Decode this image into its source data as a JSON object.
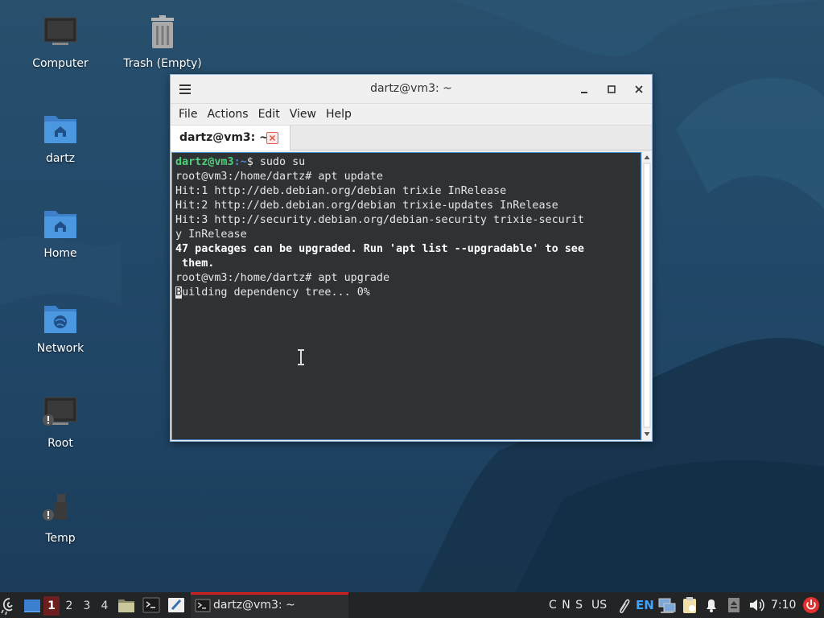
{
  "desktop": {
    "icons": [
      {
        "label": "Computer"
      },
      {
        "label": "Trash (Empty)"
      },
      {
        "label": "dartz"
      },
      {
        "label": "Home"
      },
      {
        "label": "Network"
      },
      {
        "label": "Root"
      },
      {
        "label": "Temp"
      }
    ]
  },
  "window": {
    "title": "dartz@vm3: ~",
    "menu": [
      "File",
      "Actions",
      "Edit",
      "View",
      "Help"
    ],
    "tab_label": "dartz@vm3: ~",
    "terminal": {
      "prompt_user": "dartz@vm3",
      "prompt_path": ":~",
      "prompt_symbol": "$ ",
      "cmd1": "sudo su",
      "line2": "root@vm3:/home/dartz# apt update",
      "line3": "Hit:1 http://deb.debian.org/debian trixie InRelease",
      "line4": "Hit:2 http://deb.debian.org/debian trixie-updates InRelease",
      "line5": "Hit:3 http://security.debian.org/debian-security trixie-securit",
      "line6": "y InRelease",
      "line7": "47 packages can be upgraded. Run 'apt list --upgradable' to see",
      "line8": " them.",
      "line9": "root@vm3:/home/dartz# apt upgrade",
      "line10_cursor_char": "B",
      "line10_rest": "uilding dependency tree... 0%"
    }
  },
  "taskbar": {
    "workspaces": [
      "1",
      "2",
      "3",
      "4"
    ],
    "task_label": "dartz@vm3: ~",
    "tray": {
      "keys": "C N S",
      "layout": "US",
      "lang": "EN",
      "clock": "7:10"
    }
  },
  "colors": {
    "prompt_green": "#4fd07a",
    "prompt_blue": "#4f86d6",
    "terminal_bg": "#2f3234",
    "taskbar_bg": "#222426",
    "active_workspace": "#6d1f1f",
    "power_red": "#e03030",
    "lang_blue": "#3fa3ff"
  }
}
